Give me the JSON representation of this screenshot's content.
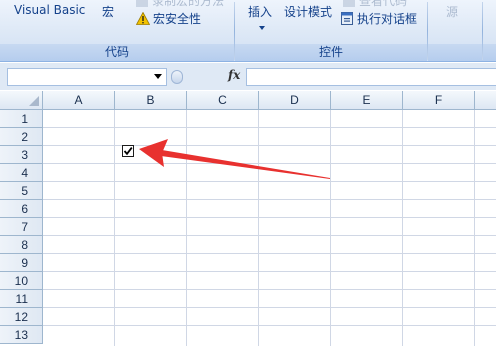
{
  "ribbon": {
    "code_group": {
      "visual_basic": "Visual Basic",
      "macro": "宏",
      "record_macro_partial": "录制宏的方法",
      "macro_security": "宏安全性",
      "label": "代码"
    },
    "controls_group": {
      "insert": "插入",
      "design_mode": "设计模式",
      "properties_partial": "查看代码",
      "run_dialog": "执行对话框",
      "label": "控件"
    },
    "xml_group": {
      "source": "源"
    }
  },
  "formula_bar": {
    "name_box_value": "",
    "fx_label": "fx",
    "formula_value": ""
  },
  "sheet": {
    "columns": [
      "A",
      "B",
      "C",
      "D",
      "E",
      "F"
    ],
    "rows": [
      "1",
      "2",
      "3",
      "4",
      "5",
      "6",
      "7",
      "8",
      "9",
      "10",
      "11",
      "12",
      "13"
    ],
    "checkbox": {
      "cell": "B3",
      "checked": true,
      "mark": "✔"
    }
  },
  "colors": {
    "arrow": "#e8312f",
    "ribbon_text": "#15428b",
    "grid_line": "#d0d7e5"
  }
}
